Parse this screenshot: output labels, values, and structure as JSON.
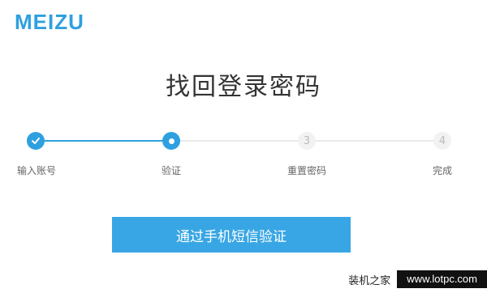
{
  "brand": {
    "logo_text": "MEIZU",
    "accent": "#2ea0e0"
  },
  "page": {
    "title": "找回登录密码"
  },
  "steps": [
    {
      "label": "输入账号",
      "state": "done",
      "icon": "check-icon"
    },
    {
      "label": "验证",
      "state": "current",
      "icon": "dot-icon"
    },
    {
      "label": "重置密码",
      "state": "todo",
      "number": "3"
    },
    {
      "label": "完成",
      "state": "todo",
      "number": "4"
    }
  ],
  "actions": {
    "sms_verify_label": "通过手机短信验证"
  },
  "watermark": {
    "left_text": "装机之家",
    "right_text": "www.lotpc.com"
  }
}
